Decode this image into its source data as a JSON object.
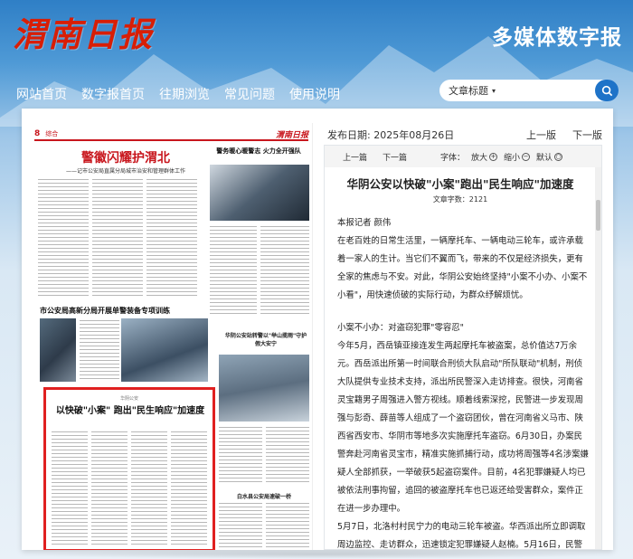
{
  "header": {
    "logo_text": "渭南日报",
    "site_subtitle": "多媒体数字报"
  },
  "nav": {
    "items": [
      "网站首页",
      "数字报首页",
      "往期浏览",
      "常见问题",
      "使用说明"
    ]
  },
  "search": {
    "selected_option": "文章标题",
    "placeholder": ""
  },
  "paper_page": {
    "page_label": "8",
    "section": "综合",
    "logo": "渭南日报",
    "headline": "警徽闪耀护渭北",
    "deck": "——记市公安局直属分局城市治安和管理群体工作",
    "right_headline": "警务暖心暖警志 火力全开强队",
    "left_headline2": "市公安局高新分局开展单警装备专项训练",
    "right_caption": "华阴公安站转警以\"举山揽雨\"守护假大安宁",
    "red_category": "华阴公安",
    "red_title": "以快破\"小案\" 跑出\"民生响应\"加速度",
    "bottom_right_caption": "白水县公安局速破一桥"
  },
  "reader": {
    "publish_date": "发布日期: 2025年08月26日",
    "prev_page": "上一版",
    "next_page": "下一版",
    "prev_article": "上一篇",
    "next_article": "下一篇",
    "font_label": "字体：",
    "zoom_in": "放大",
    "zoom_out": "缩小",
    "default": "默认",
    "title": "华阴公安以快破\"小案\"跑出\"民生响应\"加速度",
    "word_count": "文章字数：2121",
    "paragraphs": [
      "本报记者 颜伟",
      "在老百姓的日常生活里，一辆摩托车、一辆电动三轮车，或许承载着一家人的生计。当它们不翼而飞，带来的不仅是经济损失，更有全家的焦虑与不安。对此，华阴公安始终坚持\"小案不小办、小案不小看\"，用快速侦破的实际行动，为群众纾解烦忧。",
      "小案不小办：对盗窃犯罪\"零容忍\"",
      "今年5月，西岳镇亚接连发生两起摩托车被盗案，总价值达7万余元。西岳派出所第一时间联合刑侦大队启动\"所队联动\"机制，刑侦大队提供专业技术支持，派出所民警深入走访排查。很快，河南省灵宝籍男子周强进入警方视线。顺着线索深挖，民警进一步发现周强与彭奇、薛苗等人组成了一个盗窃团伙，曾在河南省义马市、陕西省西安市、华阴市等地多次实施摩托车盗窃。6月30日，办案民警奔赴河南省灵宝市，精准实施抓捕行动，成功将周强等4名涉案嫌疑人全部抓获，一举破获5起盗窃案件。目前，4名犯罪嫌疑人均已被依法刑事拘留，追回的被盗摩托车也已返还给受害群众，案件正在进一步办理中。",
      "5月7日，北洛村村民宁力的电动三轮车被盗。华西派出所立即调取周边监控、走访群众，迅速锁定犯罪嫌疑人赵楠。5月16日，民警成"
    ]
  }
}
